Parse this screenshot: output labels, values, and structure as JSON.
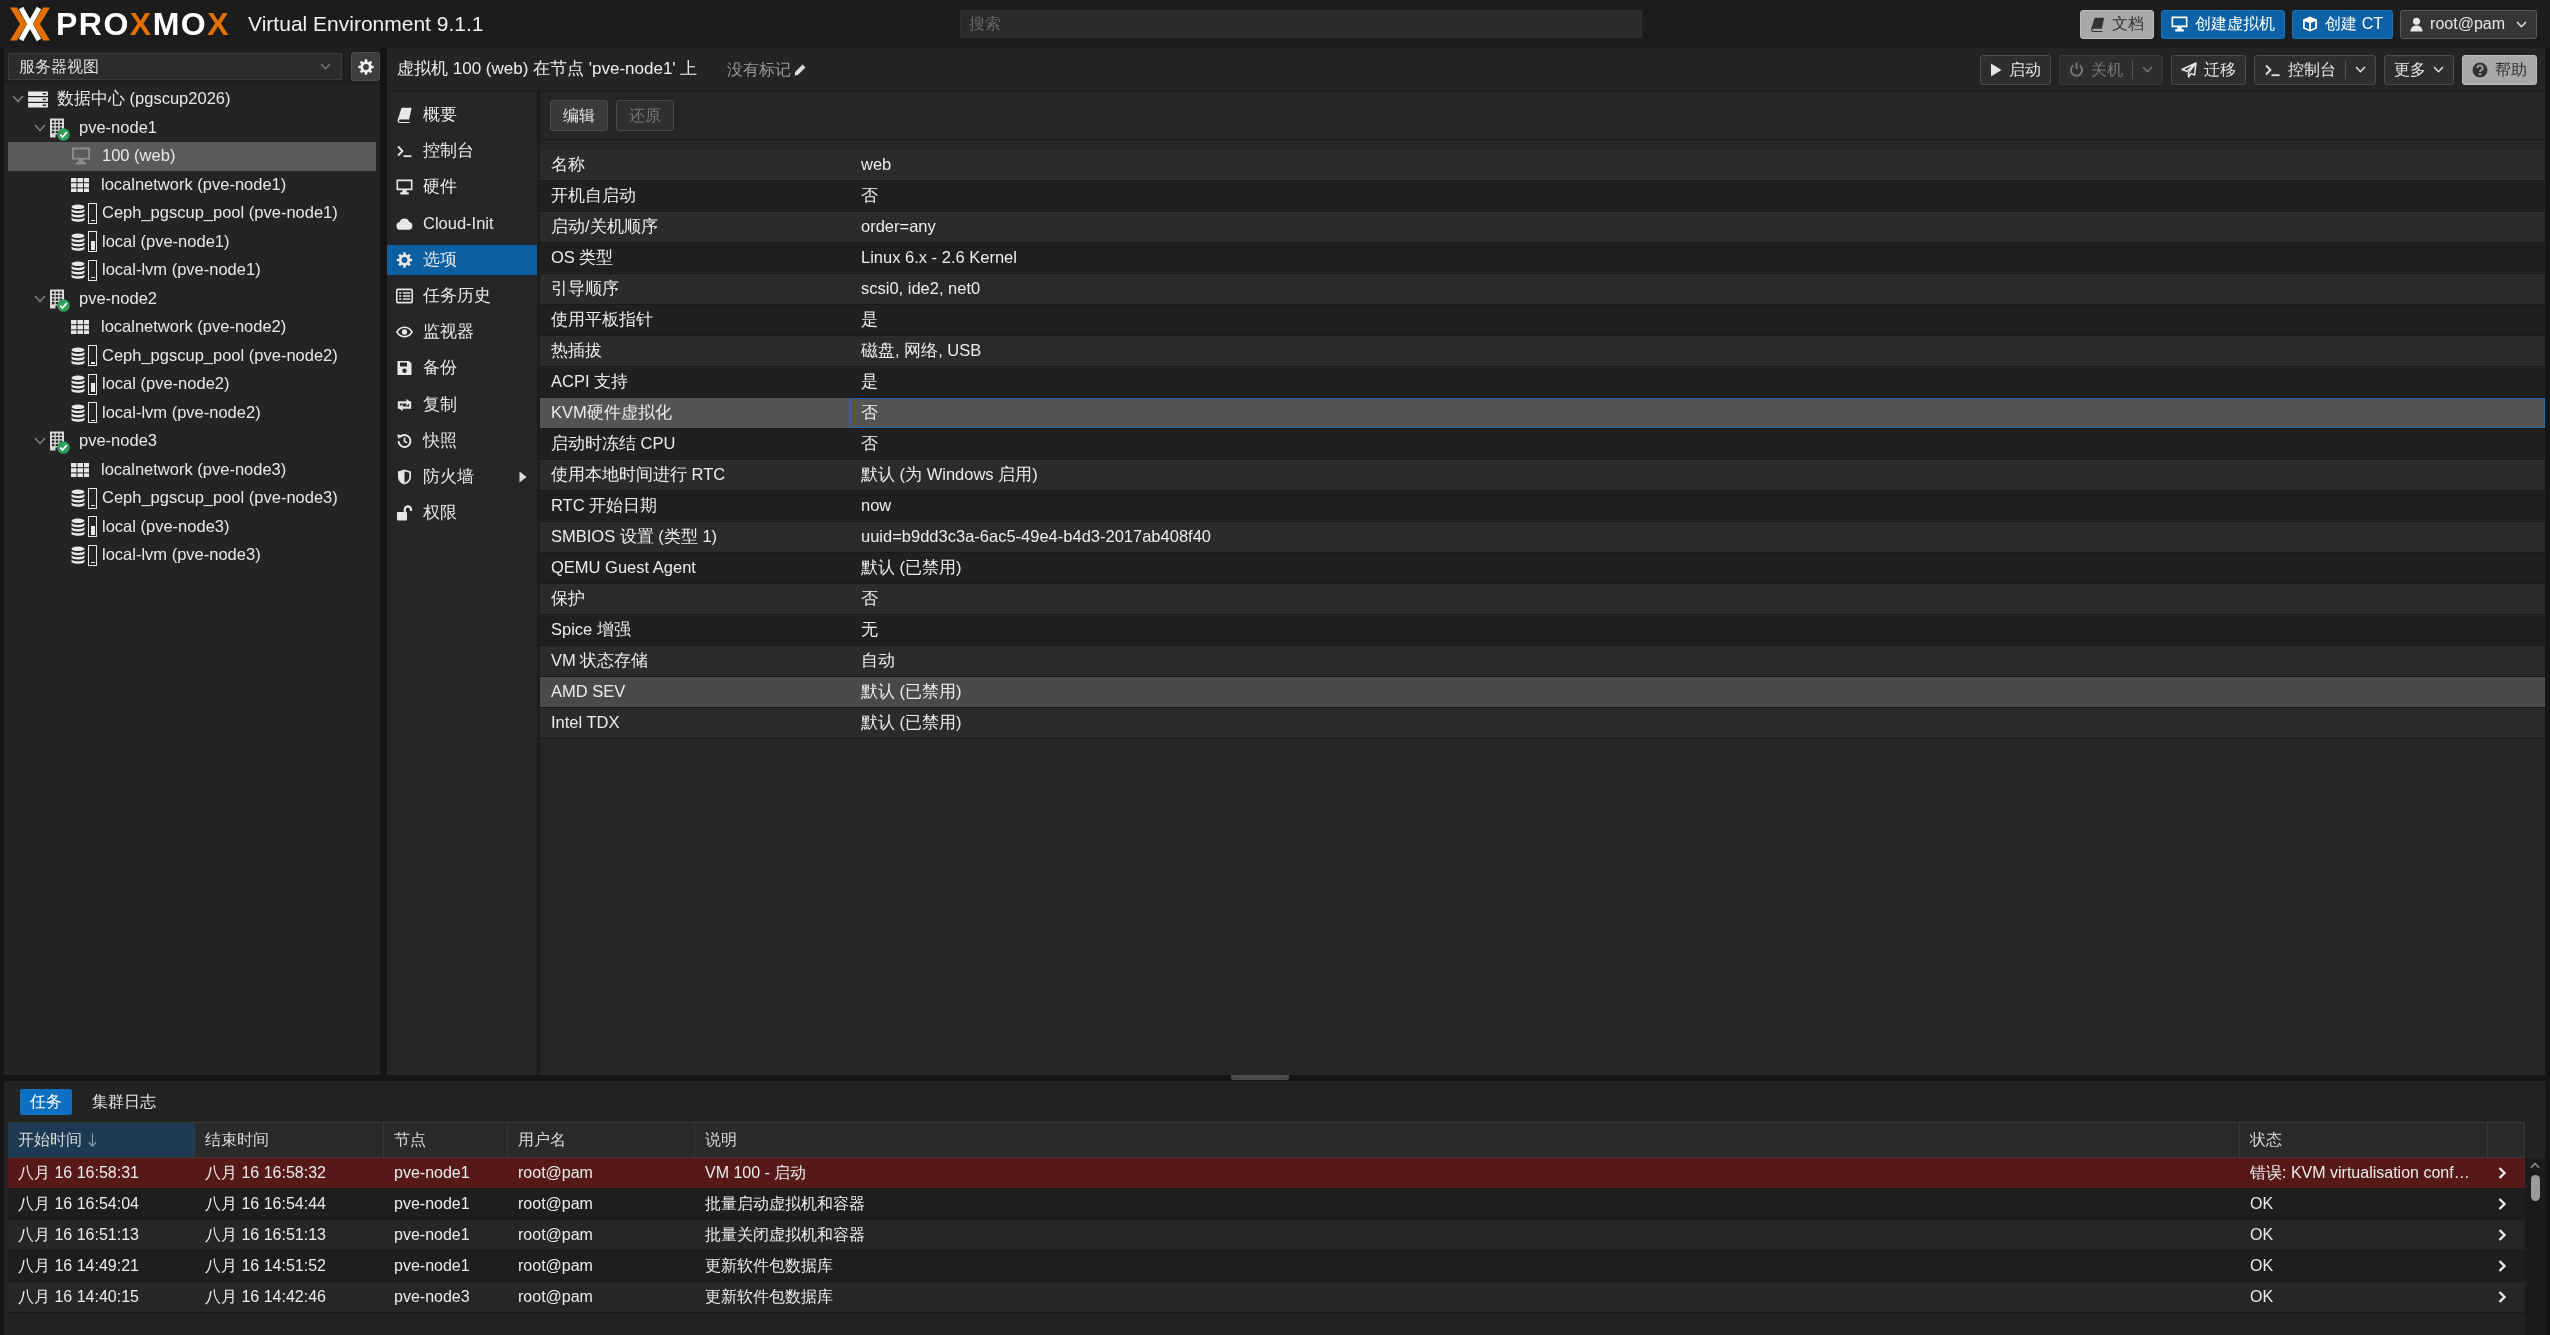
{
  "topbar": {
    "logo_parts": [
      {
        "text": "PRO",
        "accent": false
      },
      {
        "text": "X",
        "accent": true
      },
      {
        "text": "MO",
        "accent": false
      },
      {
        "text": "X",
        "accent": true
      }
    ],
    "product": "Virtual Environment 9.1.1",
    "search": {
      "placeholder": "搜索"
    },
    "buttons": [
      {
        "label": "文档",
        "kind": "default"
      },
      {
        "label": "创建虚拟机",
        "kind": "primary"
      },
      {
        "label": "创建 CT",
        "kind": "primary"
      },
      {
        "label": "root@pam",
        "kind": "menu"
      }
    ]
  },
  "sidebar": {
    "view_selector": {
      "value": "服务器视图"
    },
    "tree": [
      {
        "label": "数据中心 (pgscup2026)",
        "kind": "datacenter",
        "selected": false,
        "expanded": true,
        "children": [
          {
            "label": "pve-node1",
            "kind": "node",
            "online": true,
            "selected": false,
            "expanded": true,
            "children": [
              {
                "label": "100 (web)",
                "kind": "vm",
                "running": false,
                "selected": true
              },
              {
                "label": "localnetwork (pve-node1)",
                "kind": "sdn",
                "selected": false
              },
              {
                "label": "Ceph_pgscup_pool (pve-node1)",
                "kind": "storage",
                "level": 0.1,
                "selected": false
              },
              {
                "label": "local (pve-node1)",
                "kind": "storage",
                "level": 0.55,
                "selected": false
              },
              {
                "label": "local-lvm (pve-node1)",
                "kind": "storage",
                "level": 0.05,
                "selected": false
              }
            ]
          },
          {
            "label": "pve-node2",
            "kind": "node",
            "online": true,
            "selected": false,
            "expanded": true,
            "children": [
              {
                "label": "localnetwork (pve-node2)",
                "kind": "sdn",
                "selected": false
              },
              {
                "label": "Ceph_pgscup_pool (pve-node2)",
                "kind": "storage",
                "level": 0.1,
                "selected": false
              },
              {
                "label": "local (pve-node2)",
                "kind": "storage",
                "level": 0.55,
                "selected": false
              },
              {
                "label": "local-lvm (pve-node2)",
                "kind": "storage",
                "level": 0.05,
                "selected": false
              }
            ]
          },
          {
            "label": "pve-node3",
            "kind": "node",
            "online": true,
            "selected": false,
            "expanded": true,
            "children": [
              {
                "label": "localnetwork (pve-node3)",
                "kind": "sdn",
                "selected": false
              },
              {
                "label": "Ceph_pgscup_pool (pve-node3)",
                "kind": "storage",
                "level": 0.1,
                "selected": false
              },
              {
                "label": "local (pve-node3)",
                "kind": "storage",
                "level": 0.55,
                "selected": false
              },
              {
                "label": "local-lvm (pve-node3)",
                "kind": "storage",
                "level": 0.05,
                "selected": false
              }
            ]
          }
        ]
      }
    ]
  },
  "vm_header": {
    "title": "虚拟机 100 (web) 在节点 'pve-node1' 上",
    "tags": "没有标记"
  },
  "toolbar": [
    {
      "label": "启动",
      "kind": "button",
      "disabled": false
    },
    {
      "label": "关机",
      "kind": "split",
      "disabled": true
    },
    {
      "label": "迁移",
      "kind": "button",
      "disabled": false
    },
    {
      "label": "控制台",
      "kind": "split",
      "disabled": false
    },
    {
      "label": "更多",
      "kind": "menu",
      "disabled": false
    },
    {
      "label": "帮助",
      "kind": "help",
      "disabled": false
    }
  ],
  "nav_menu": [
    {
      "label": "概要",
      "selected": false,
      "submenu": false
    },
    {
      "label": "控制台",
      "selected": false,
      "submenu": false
    },
    {
      "label": "硬件",
      "selected": false,
      "submenu": false
    },
    {
      "label": "Cloud-Init",
      "selected": false,
      "submenu": false
    },
    {
      "label": "选项",
      "selected": true,
      "submenu": false
    },
    {
      "label": "任务历史",
      "selected": false,
      "submenu": false
    },
    {
      "label": "监视器",
      "selected": false,
      "submenu": false
    },
    {
      "label": "备份",
      "selected": false,
      "submenu": false
    },
    {
      "label": "复制",
      "selected": false,
      "submenu": false
    },
    {
      "label": "快照",
      "selected": false,
      "submenu": false
    },
    {
      "label": "防火墙",
      "selected": false,
      "submenu": true
    },
    {
      "label": "权限",
      "selected": false,
      "submenu": false
    }
  ],
  "options_toolbar": [
    {
      "label": "编辑",
      "disabled": false
    },
    {
      "label": "还原",
      "disabled": true
    }
  ],
  "options": [
    {
      "key": "名称",
      "value": "web",
      "selected": false,
      "hovered": false
    },
    {
      "key": "开机自启动",
      "value": "否",
      "selected": false,
      "hovered": false
    },
    {
      "key": "启动/关机顺序",
      "value": "order=any",
      "selected": false,
      "hovered": false
    },
    {
      "key": "OS 类型",
      "value": "Linux 6.x - 2.6 Kernel",
      "selected": false,
      "hovered": false
    },
    {
      "key": "引导顺序",
      "value": "scsi0, ide2, net0",
      "selected": false,
      "hovered": false
    },
    {
      "key": "使用平板指针",
      "value": "是",
      "selected": false,
      "hovered": false
    },
    {
      "key": "热插拔",
      "value": "磁盘, 网络, USB",
      "selected": false,
      "hovered": false
    },
    {
      "key": "ACPI 支持",
      "value": "是",
      "selected": false,
      "hovered": false
    },
    {
      "key": "KVM硬件虚拟化",
      "value": "否",
      "selected": true,
      "hovered": false
    },
    {
      "key": "启动时冻结 CPU",
      "value": "否",
      "selected": false,
      "hovered": false
    },
    {
      "key": "使用本地时间进行 RTC",
      "value": "默认 (为 Windows 启用)",
      "selected": false,
      "hovered": false
    },
    {
      "key": "RTC 开始日期",
      "value": "now",
      "selected": false,
      "hovered": false
    },
    {
      "key": "SMBIOS 设置 (类型 1)",
      "value": "uuid=b9dd3c3a-6ac5-49e4-b4d3-2017ab408f40",
      "selected": false,
      "hovered": false
    },
    {
      "key": "QEMU Guest Agent",
      "value": "默认 (已禁用)",
      "selected": false,
      "hovered": false
    },
    {
      "key": "保护",
      "value": "否",
      "selected": false,
      "hovered": false
    },
    {
      "key": "Spice 增强",
      "value": "无",
      "selected": false,
      "hovered": false
    },
    {
      "key": "VM 状态存储",
      "value": "自动",
      "selected": false,
      "hovered": false
    },
    {
      "key": "AMD SEV",
      "value": "默认 (已禁用)",
      "selected": false,
      "hovered": true
    },
    {
      "key": "Intel TDX",
      "value": "默认 (已禁用)",
      "selected": false,
      "hovered": false
    }
  ],
  "bottom_panel": {
    "tabs": [
      {
        "label": "任务",
        "selected": true
      },
      {
        "label": "集群日志",
        "selected": false
      }
    ],
    "columns": [
      {
        "label": "开始时间",
        "sorted": true
      },
      {
        "label": "结束时间",
        "sorted": false
      },
      {
        "label": "节点",
        "sorted": false
      },
      {
        "label": "用户名",
        "sorted": false
      },
      {
        "label": "说明",
        "sorted": false
      },
      {
        "label": "状态",
        "sorted": false
      }
    ],
    "rows": [
      {
        "start": "八月 16 16:58:31",
        "end": "八月 16 16:58:32",
        "node": "pve-node1",
        "user": "root@pam",
        "description": "VM 100 - 启动",
        "status": "错误: KVM virtualisation conf…",
        "error": true
      },
      {
        "start": "八月 16 16:54:04",
        "end": "八月 16 16:54:44",
        "node": "pve-node1",
        "user": "root@pam",
        "description": "批量启动虚拟机和容器",
        "status": "OK",
        "error": false
      },
      {
        "start": "八月 16 16:51:13",
        "end": "八月 16 16:51:13",
        "node": "pve-node1",
        "user": "root@pam",
        "description": "批量关闭虚拟机和容器",
        "status": "OK",
        "error": false
      },
      {
        "start": "八月 16 14:49:21",
        "end": "八月 16 14:51:52",
        "node": "pve-node1",
        "user": "root@pam",
        "description": "更新软件包数据库",
        "status": "OK",
        "error": false
      },
      {
        "start": "八月 16 14:40:15",
        "end": "八月 16 14:42:46",
        "node": "pve-node3",
        "user": "root@pam",
        "description": "更新软件包数据库",
        "status": "OK",
        "error": false
      }
    ]
  }
}
